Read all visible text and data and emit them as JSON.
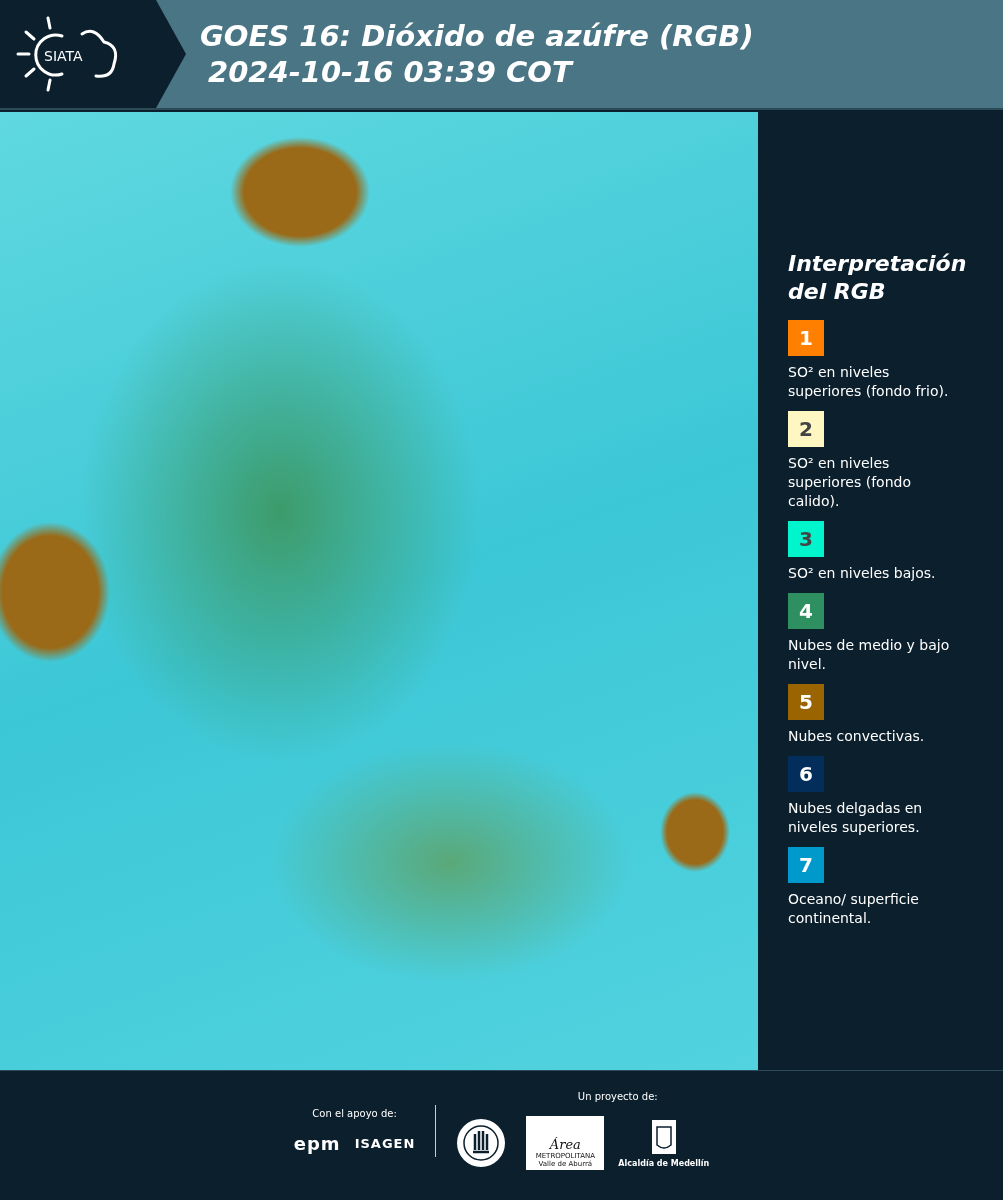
{
  "header": {
    "logo_text": "SIATA",
    "title": "GOES 16: Dióxido de azúfre (RGB)",
    "subtitle": "2024-10-16 03:39 COT"
  },
  "legend": {
    "title": "Interpretación del RGB",
    "items": [
      {
        "number": "1",
        "color": "#ff7f00",
        "text": "SO² en niveles superiores (fondo frio)."
      },
      {
        "number": "2",
        "color": "#fff7c2",
        "text": "SO² en niveles superiores (fondo calido)."
      },
      {
        "number": "3",
        "color": "#00f5cc",
        "text": "SO² en niveles bajos."
      },
      {
        "number": "4",
        "color": "#2e8f60",
        "text": "Nubes de medio y bajo nivel."
      },
      {
        "number": "5",
        "color": "#9a6400",
        "text": "Nubes convectivas."
      },
      {
        "number": "6",
        "color": "#032e5c",
        "text": "Nubes delgadas en niveles superiores."
      },
      {
        "number": "7",
        "color": "#0099cc",
        "text": "Oceano/ superficie continental."
      }
    ]
  },
  "footer": {
    "support_label": "Con el apoyo de:",
    "support_logos": [
      "epm",
      "ISAGEN"
    ],
    "project_label": "Un proyecto de:",
    "area_logo": {
      "name": "Área",
      "line_1": "METROPOLITANA",
      "line_2": "Valle de Aburrá"
    },
    "alcaldia_label": "Alcaldía de Medellín"
  }
}
